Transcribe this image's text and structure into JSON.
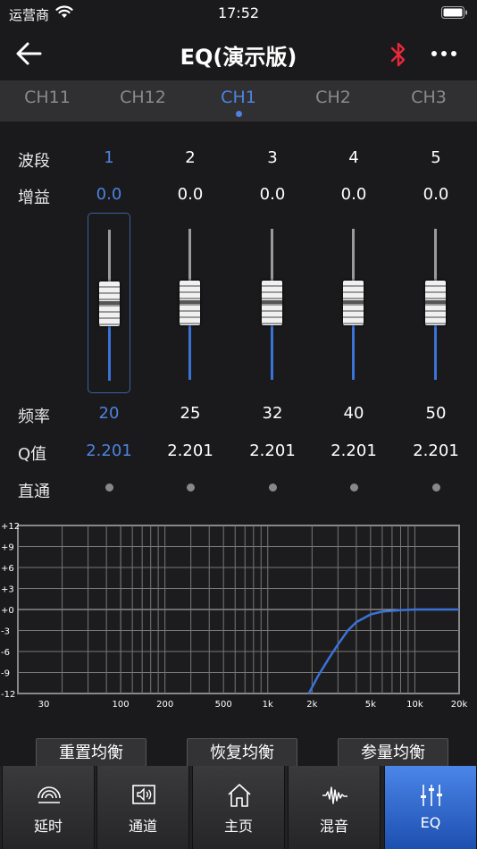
{
  "status": {
    "carrier": "运营商",
    "time": "17:52"
  },
  "nav": {
    "title": "EQ(演示版)"
  },
  "tabs": [
    {
      "label": "CH11",
      "active": false
    },
    {
      "label": "CH12",
      "active": false
    },
    {
      "label": "CH1",
      "active": true
    },
    {
      "label": "CH2",
      "active": false
    },
    {
      "label": "CH3",
      "active": false
    }
  ],
  "rows": {
    "band": "波段",
    "gain": "增益",
    "freq": "频率",
    "q": "Q值",
    "bypass": "直通"
  },
  "bands": [
    {
      "band": "1",
      "gain": "0.0",
      "freq": "20",
      "q": "2.201",
      "selected": true,
      "level": 0
    },
    {
      "band": "2",
      "gain": "0.0",
      "freq": "25",
      "q": "2.201",
      "selected": false,
      "level": 0
    },
    {
      "band": "3",
      "gain": "0.0",
      "freq": "32",
      "q": "2.201",
      "selected": false,
      "level": 0
    },
    {
      "band": "4",
      "gain": "0.0",
      "freq": "40",
      "q": "2.201",
      "selected": false,
      "level": 0
    },
    {
      "band": "5",
      "gain": "0.0",
      "freq": "50",
      "q": "2.201",
      "selected": false,
      "level": 0
    }
  ],
  "chart_data": {
    "type": "line",
    "y_ticks": [
      "+12",
      "+9",
      "+6",
      "+3",
      "+0",
      "-3",
      "-6",
      "-9",
      "-12"
    ],
    "x_ticks": [
      "30",
      "100",
      "200",
      "500",
      "1k",
      "2k",
      "5k",
      "10k",
      "20k"
    ],
    "ylim": [
      -12,
      12
    ],
    "xlim": [
      20,
      20000
    ],
    "x_scale": "log",
    "series": [
      {
        "x": [
          1900,
          2200,
          2600,
          3000,
          3500,
          4000,
          5000,
          6000,
          8000,
          10000,
          20000
        ],
        "y": [
          -12,
          -9.5,
          -7,
          -5,
          -3,
          -1.8,
          -0.7,
          -0.3,
          -0.1,
          0,
          0
        ]
      }
    ]
  },
  "actions": {
    "reset": "重置均衡",
    "restore": "恢复均衡",
    "param": "参量均衡"
  },
  "bottom_nav": [
    {
      "label": "延时",
      "icon": "delay-icon",
      "active": false
    },
    {
      "label": "通道",
      "icon": "speaker-icon",
      "active": false
    },
    {
      "label": "主页",
      "icon": "home-icon",
      "active": false
    },
    {
      "label": "混音",
      "icon": "waveform-icon",
      "active": false
    },
    {
      "label": "EQ",
      "icon": "sliders-icon",
      "active": true
    }
  ],
  "colors": {
    "accent": "#4d83e0",
    "bluetooth": "#e8283a",
    "curve": "#3a72d8"
  }
}
